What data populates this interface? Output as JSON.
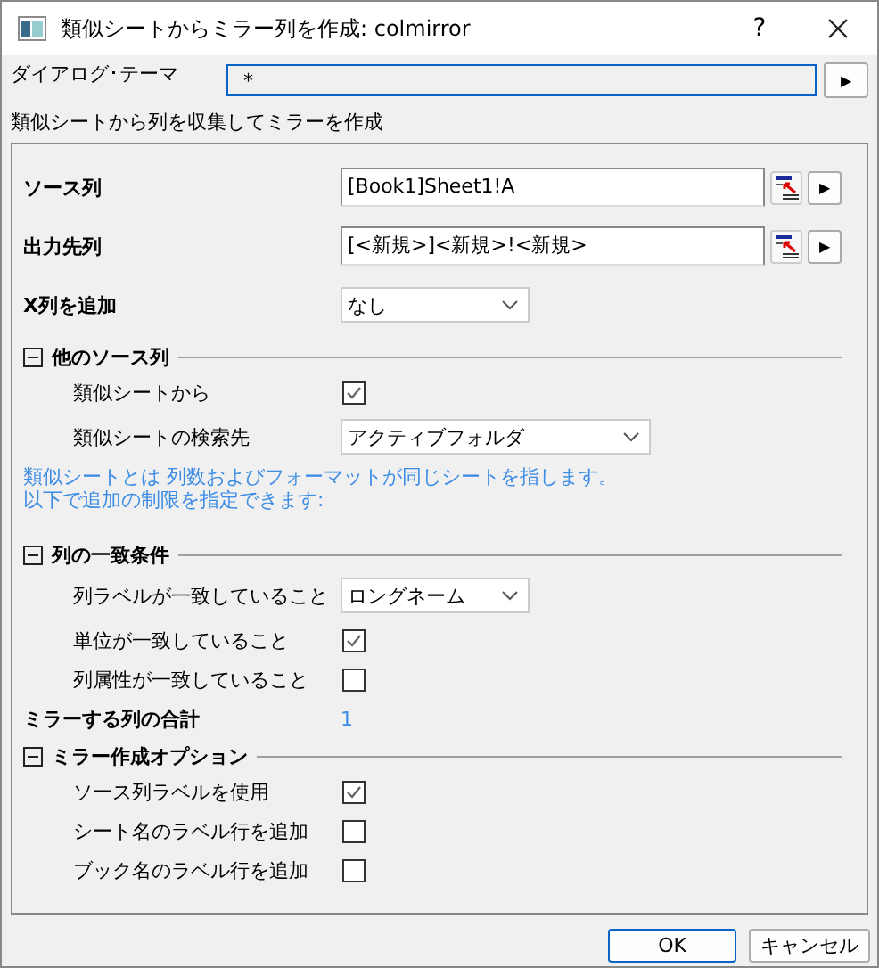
{
  "window": {
    "title": "類似シートからミラー列を作成: colmirror",
    "help": "?"
  },
  "theme": {
    "label": "ダイアログ･テーマ",
    "value": "*",
    "button": "▶"
  },
  "description": "類似シートから列を収集してミラーを作成",
  "items": [
    {
      "kind": "field",
      "label": "ソース列",
      "value": "[Book1]Sheet1!A",
      "button": "▶"
    },
    {
      "kind": "field",
      "label": "出力先列",
      "value": "[<新規>]<新規>!<新規>",
      "button": "▶"
    },
    {
      "kind": "dropdown",
      "label": "X列を追加",
      "value": "なし"
    },
    {
      "kind": "section",
      "label": "他のソース列",
      "expanded": true,
      "children": [
        {
          "kind": "checkbox",
          "label": "類似シートから",
          "checked": true
        },
        {
          "kind": "wide_dropdown",
          "label": "類似シートの検索先",
          "value": "アクティブフォルダ"
        }
      ]
    },
    {
      "kind": "note",
      "lines": [
        "類似シートとは 列数およびフォーマットが同じシートを指します。",
        "以下で追加の制限を指定できます:"
      ]
    },
    {
      "kind": "section",
      "label": "列の一致条件",
      "expanded": true,
      "children": [
        {
          "kind": "dropdown",
          "label": "列ラベルが一致していること",
          "value": "ロングネーム"
        },
        {
          "kind": "checkbox",
          "label": "単位が一致していること",
          "checked": true
        },
        {
          "kind": "checkbox",
          "label": "列属性が一致していること",
          "checked": false
        }
      ]
    },
    {
      "kind": "count",
      "label": "ミラーする列の合計",
      "value": "1"
    },
    {
      "kind": "section",
      "label": "ミラー作成オプション",
      "expanded": true,
      "children": [
        {
          "kind": "checkbox",
          "label": "ソース列ラベルを使用",
          "checked": true
        },
        {
          "kind": "checkbox",
          "label": "シート名のラベル行を追加",
          "checked": false
        },
        {
          "kind": "checkbox",
          "label": "ブック名のラベル行を追加",
          "checked": false
        }
      ]
    }
  ],
  "buttons": [
    {
      "label": "OK",
      "default": true
    },
    {
      "label": "キャンセル",
      "default": false
    }
  ]
}
